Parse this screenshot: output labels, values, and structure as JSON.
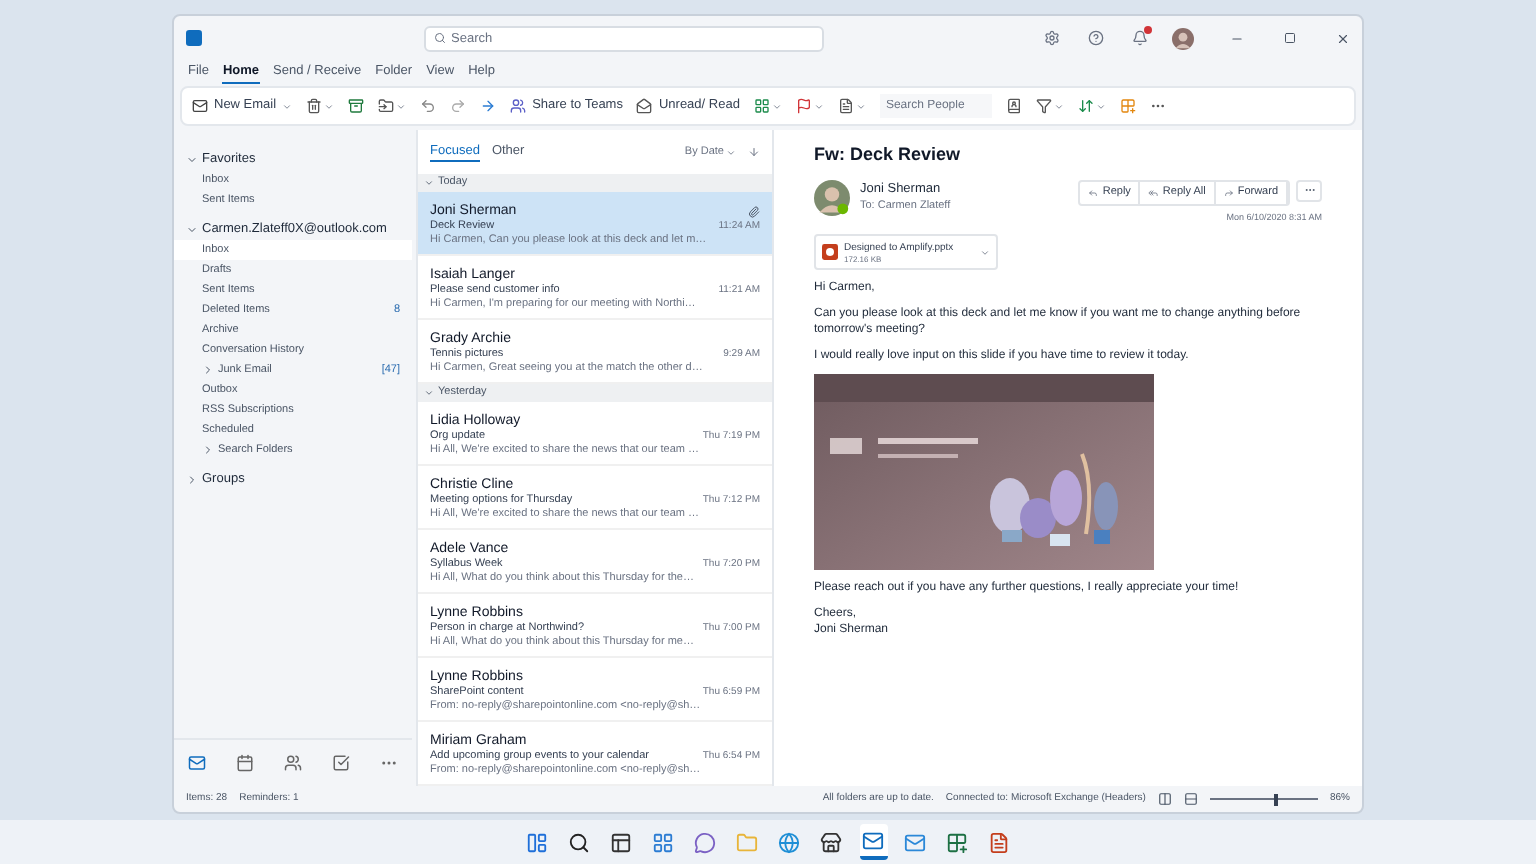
{
  "window": {
    "search_placeholder": "Search"
  },
  "menu_tabs": [
    {
      "label": "File",
      "selected": false
    },
    {
      "label": "Home",
      "selected": true
    },
    {
      "label": "Send / Receive",
      "selected": false
    },
    {
      "label": "Folder",
      "selected": false
    },
    {
      "label": "View",
      "selected": false
    },
    {
      "label": "Help",
      "selected": false
    }
  ],
  "ribbon": [
    {
      "kind": "labeled",
      "label": "New Email",
      "dropdown": true
    },
    {
      "kind": "icon",
      "dropdown": true
    },
    {
      "kind": "icon",
      "dropdown": false
    },
    {
      "kind": "icon",
      "dropdown": true
    },
    {
      "kind": "icon",
      "dropdown": false
    },
    {
      "kind": "icon",
      "dropdown": false
    },
    {
      "kind": "icon",
      "dropdown": false
    },
    {
      "kind": "labeled",
      "label": "Share to Teams",
      "dropdown": false
    },
    {
      "kind": "labeled",
      "label": "Unread/ Read",
      "dropdown": false
    },
    {
      "kind": "icon",
      "dropdown": true
    },
    {
      "kind": "icon",
      "dropdown": true
    },
    {
      "kind": "icon",
      "dropdown": true
    },
    {
      "kind": "field",
      "placeholder": "Search People"
    },
    {
      "kind": "icon",
      "dropdown": false
    },
    {
      "kind": "icon",
      "dropdown": true
    },
    {
      "kind": "icon",
      "dropdown": true
    },
    {
      "kind": "icon",
      "dropdown": false
    },
    {
      "kind": "icon",
      "dropdown": false
    }
  ],
  "folders": [
    {
      "label": "Favorites",
      "expanded": true,
      "children": [
        {
          "label": "Inbox",
          "selected": false
        },
        {
          "label": "Sent Items",
          "selected": false
        }
      ]
    },
    {
      "label": "Carmen.Zlateff0X@outlook.com",
      "expanded": true,
      "children": [
        {
          "label": "Inbox",
          "selected": true
        },
        {
          "label": "Drafts",
          "selected": false
        },
        {
          "label": "Sent Items",
          "selected": false
        },
        {
          "label": "Deleted Items",
          "count": "8",
          "selected": false
        },
        {
          "label": "Archive",
          "selected": false
        },
        {
          "label": "Conversation History",
          "selected": false
        },
        {
          "label": "Junk Email",
          "count": "[47]",
          "expanded": false,
          "selected": false
        },
        {
          "label": "Outbox",
          "selected": false
        },
        {
          "label": "RSS Subscriptions",
          "selected": false
        },
        {
          "label": "Scheduled",
          "selected": false
        },
        {
          "label": "Search Folders",
          "expanded": false,
          "selected": false
        }
      ]
    },
    {
      "label": "Groups",
      "expanded": false
    }
  ],
  "nav_modules": [
    {
      "selected": true
    },
    {
      "selected": false
    },
    {
      "selected": false
    },
    {
      "selected": false
    },
    {
      "selected": false
    }
  ],
  "message_list": {
    "tabs": [
      {
        "label": "Focused",
        "selected": true
      },
      {
        "label": "Other",
        "selected": false
      }
    ],
    "sort": "By Date",
    "groups": [
      {
        "label": "Today",
        "expanded": true,
        "messages": [
          {
            "sender": "Joni Sherman",
            "subject": "Deck Review",
            "preview": "Hi Carmen, Can you please look at this deck and let m…",
            "time": "11:24 AM",
            "attachment": true,
            "selected": true
          },
          {
            "sender": "Isaiah Langer",
            "subject": "Please send customer info",
            "preview": "Hi Carmen, I'm preparing for our meeting with Northi…",
            "time": "11:21 AM",
            "attachment": false,
            "selected": false
          },
          {
            "sender": "Grady Archie",
            "subject": "Tennis pictures",
            "preview": "Hi Carmen, Great seeing you at the match the other d…",
            "time": "9:29 AM",
            "attachment": false,
            "selected": false
          }
        ]
      },
      {
        "label": "Yesterday",
        "expanded": true,
        "messages": [
          {
            "sender": "Lidia Holloway",
            "subject": "Org update",
            "preview": "Hi All, We're excited to share the news that our team …",
            "time": "Thu 7:19 PM",
            "attachment": false,
            "selected": false
          },
          {
            "sender": "Christie Cline",
            "subject": "Meeting options for Thursday",
            "preview": "Hi All, We're excited to share the news that our team …",
            "time": "Thu 7:12 PM",
            "attachment": false,
            "selected": false
          },
          {
            "sender": "Adele Vance",
            "subject": "Syllabus Week",
            "preview": "Hi All, What do you think about this Thursday for the…",
            "time": "Thu 7:20 PM",
            "attachment": false,
            "selected": false
          },
          {
            "sender": "Lynne Robbins",
            "subject": "Person in charge at Northwind?",
            "preview": "Hi All, What do you think about this Thursday for me…",
            "time": "Thu 7:00 PM",
            "attachment": false,
            "selected": false
          },
          {
            "sender": "Lynne Robbins",
            "subject": "SharePoint content",
            "preview": "From: no-reply@sharepointonline.com <no-reply@sh…",
            "time": "Thu 6:59 PM",
            "attachment": false,
            "selected": false
          },
          {
            "sender": "Miriam Graham",
            "subject": "Add upcoming group events to your calendar",
            "preview": "From: no-reply@sharepointonline.com <no-reply@sh…",
            "time": "Thu 6:54 PM",
            "attachment": false,
            "selected": false
          }
        ]
      }
    ]
  },
  "reading_pane": {
    "subject": "Fw: Deck Review",
    "sender": "Joni Sherman",
    "to": "To: Carmen Zlateff",
    "actions": [
      "Reply",
      "Reply All",
      "Forward"
    ],
    "date": "Mon 6/10/2020 8:31 AM",
    "attachment": {
      "name": "Designed to Amplify.pptx",
      "size": "172.16 KB"
    },
    "body": [
      {
        "kind": "text",
        "text": "Hi Carmen,"
      },
      {
        "kind": "text",
        "text": "Can you please look at this deck and let me know if you want me to change anything before tomorrow's meeting?"
      },
      {
        "kind": "text",
        "text": "I would really love input on this slide if you have time to review it today."
      },
      {
        "kind": "picture"
      },
      {
        "kind": "text",
        "text": "Please reach out if you have any further questions, I really appreciate your time!"
      },
      {
        "kind": "signature",
        "lines": [
          "Cheers,",
          "Joni Sherman"
        ]
      }
    ]
  },
  "status_bar": {
    "items": "Items: 28",
    "reminders": "Reminders: 1",
    "sync": "All folders are up to date.",
    "connection": "Connected to: Microsoft Exchange (Headers)",
    "zoom": {
      "level": 0.62,
      "reading": "86%"
    }
  },
  "taskbar": [
    {
      "selected": false
    },
    {
      "selected": false
    },
    {
      "selected": false
    },
    {
      "selected": false
    },
    {
      "selected": false
    },
    {
      "selected": false
    },
    {
      "selected": false
    },
    {
      "selected": false
    },
    {
      "selected": true
    },
    {
      "selected": false
    },
    {
      "selected": false
    },
    {
      "selected": false
    }
  ]
}
